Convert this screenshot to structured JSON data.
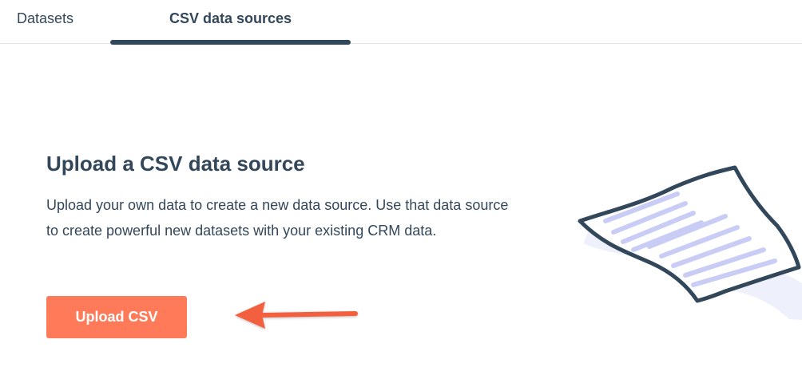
{
  "tabs": [
    {
      "label": "Datasets",
      "active": false
    },
    {
      "label": "CSV data sources",
      "active": true
    }
  ],
  "main": {
    "heading": "Upload a CSV data source",
    "description": "Upload your own data to create a new data source. Use that data source to create powerful new datasets with your existing CRM data.",
    "upload_button_label": "Upload CSV"
  },
  "annotation": {
    "arrow_color": "#f2603f",
    "arrow_icon": "arrow-left-icon"
  },
  "illustration": {
    "icon": "document-page-icon"
  },
  "colors": {
    "text": "#33475b",
    "button": "#ff7a59",
    "tab_border": "#dfe3eb",
    "illustration_accent": "#c9cdf5"
  }
}
